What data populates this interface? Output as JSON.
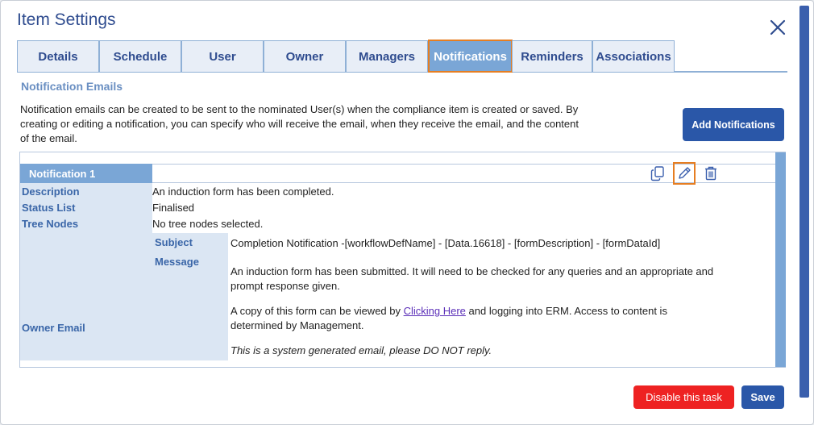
{
  "dialog": {
    "title": "Item Settings",
    "close_icon": "close-icon"
  },
  "tabs": [
    {
      "label": "Details"
    },
    {
      "label": "Schedule"
    },
    {
      "label": "User"
    },
    {
      "label": "Owner"
    },
    {
      "label": "Managers"
    },
    {
      "label": "Notifications",
      "active": true
    },
    {
      "label": "Reminders"
    },
    {
      "label": "Associations"
    }
  ],
  "section": {
    "heading": "Notification Emails",
    "intro": "Notification emails can be created to be sent to the nominated User(s) when the compliance item is created or saved. By creating or editing a notification, you can specify who will receive the email, when they receive the email, and the content of the email.",
    "add_button": "Add Notifications"
  },
  "notification": {
    "header": "Notification 1",
    "rows": [
      {
        "label": "Description",
        "value": "An induction form has been completed."
      },
      {
        "label": "Status List",
        "value": "Finalised"
      },
      {
        "label": "Tree Nodes",
        "value": "No tree nodes selected."
      },
      {
        "label": "Owner Email",
        "value": ""
      }
    ],
    "subject_label": "Subject",
    "subject_value": "Completion Notification -[workflowDefName] - [Data.16618] - [formDescription] - [formDataId]",
    "message_label": "Message",
    "message_para1": "An induction form has been submitted. It will need to be checked for any queries and an appropriate and prompt response given.",
    "message_para2_before": "A copy of this form can be viewed by ",
    "message_link": "Clicking Here",
    "message_para2_after": " and logging into ERM. Access to content is determined by Management.",
    "message_para3": "This is a system generated email, please DO NOT reply.",
    "icons": [
      "copy-icon",
      "edit-icon",
      "delete-icon"
    ]
  },
  "footer": {
    "disable_button": "Disable this task",
    "save_button": "Save"
  },
  "colors": {
    "accent": "#2a57a8",
    "tab_active": "#7aa6d6",
    "danger": "#ee2222",
    "highlight": "#e67e22"
  }
}
